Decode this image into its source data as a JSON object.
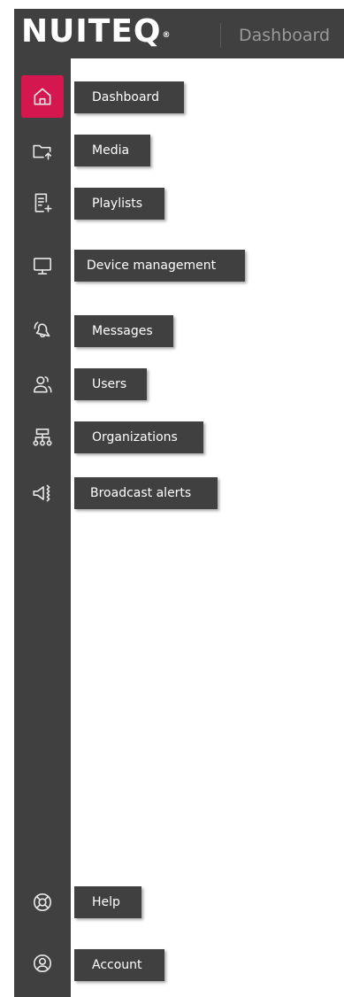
{
  "topbar": {
    "logo_text": "NUITEQ",
    "logo_mark": "®",
    "page_title": "Dashboard"
  },
  "nav": {
    "items": [
      {
        "label": "Dashboard",
        "icon": "home-icon",
        "active": true
      },
      {
        "label": "Media",
        "icon": "folder-upload-icon"
      },
      {
        "label": "Playlists",
        "icon": "playlist-add-icon"
      },
      {
        "label": "Device management",
        "icon": "monitor-icon"
      },
      {
        "label": "Messages",
        "icon": "bell-ring-icon"
      },
      {
        "label": "Users",
        "icon": "users-icon"
      },
      {
        "label": "Organizations",
        "icon": "org-tree-icon"
      },
      {
        "label": "Broadcast alerts",
        "icon": "megaphone-icon"
      },
      {
        "label": "Help",
        "icon": "lifebuoy-icon"
      },
      {
        "label": "Account",
        "icon": "user-circle-icon"
      }
    ]
  },
  "colors": {
    "sidebar_bg": "#404040",
    "active_accent": "#d4174f",
    "page_bg": "#ffffff"
  }
}
